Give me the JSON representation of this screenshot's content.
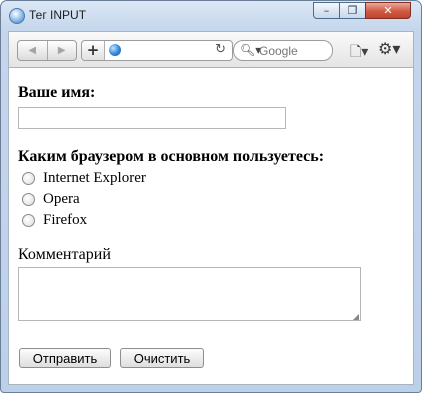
{
  "window": {
    "title": "Тег INPUT"
  },
  "titlebar_buttons": {
    "minimize": "–",
    "maximize": "❐",
    "close": "✕"
  },
  "toolbar": {
    "back": "◀",
    "forward": "▶",
    "add": "+",
    "reload": "↻",
    "search_placeholder": "Google",
    "page_menu": "🗋▾",
    "settings_menu": "⚙▾"
  },
  "form": {
    "name_label": "Ваше имя:",
    "name_value": "",
    "browser_question": "Каким браузером в основном пользуетесь:",
    "browser_options": [
      "Internet Explorer",
      "Opera",
      "Firefox"
    ],
    "comment_label": "Комментарий",
    "comment_value": "",
    "submit_label": "Отправить",
    "reset_label": "Очистить"
  },
  "icons": [
    "app-globe-icon",
    "back-icon",
    "forward-icon",
    "plus-icon",
    "globe-icon",
    "reload-icon",
    "search-icon",
    "page-icon",
    "gear-icon"
  ]
}
